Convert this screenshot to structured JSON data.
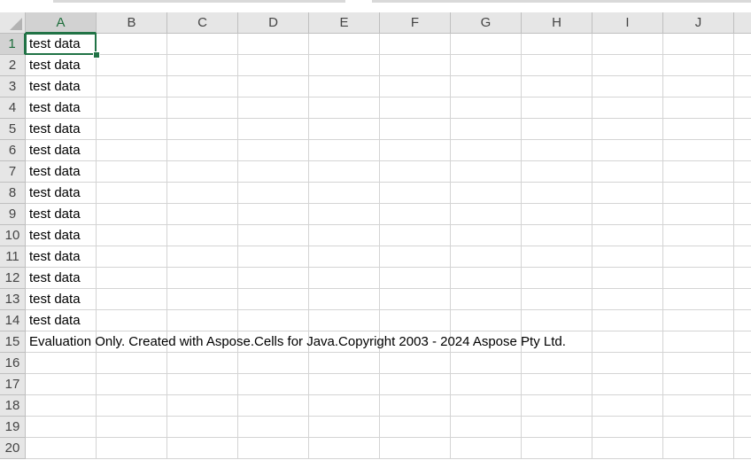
{
  "app": "Spreadsheet",
  "columns": [
    "A",
    "B",
    "C",
    "D",
    "E",
    "F",
    "G",
    "H",
    "I",
    "J"
  ],
  "rows": [
    "1",
    "2",
    "3",
    "4",
    "5",
    "6",
    "7",
    "8",
    "9",
    "10",
    "11",
    "12",
    "13",
    "14",
    "15",
    "16",
    "17",
    "18",
    "19",
    "20"
  ],
  "active_cell": "A1",
  "cells": [
    {
      "ref": "A1",
      "row": 1,
      "col": "A",
      "value": "test data"
    },
    {
      "ref": "A2",
      "row": 2,
      "col": "A",
      "value": "test data"
    },
    {
      "ref": "A3",
      "row": 3,
      "col": "A",
      "value": "test data"
    },
    {
      "ref": "A4",
      "row": 4,
      "col": "A",
      "value": "test data"
    },
    {
      "ref": "A5",
      "row": 5,
      "col": "A",
      "value": "test data"
    },
    {
      "ref": "A6",
      "row": 6,
      "col": "A",
      "value": "test data"
    },
    {
      "ref": "A7",
      "row": 7,
      "col": "A",
      "value": "test data"
    },
    {
      "ref": "A8",
      "row": 8,
      "col": "A",
      "value": "test data"
    },
    {
      "ref": "A9",
      "row": 9,
      "col": "A",
      "value": "test data"
    },
    {
      "ref": "A10",
      "row": 10,
      "col": "A",
      "value": "test data"
    },
    {
      "ref": "A11",
      "row": 11,
      "col": "A",
      "value": "test data"
    },
    {
      "ref": "A12",
      "row": 12,
      "col": "A",
      "value": "test data"
    },
    {
      "ref": "A13",
      "row": 13,
      "col": "A",
      "value": "test data"
    },
    {
      "ref": "A14",
      "row": 14,
      "col": "A",
      "value": "test data"
    },
    {
      "ref": "A15",
      "row": 15,
      "col": "A",
      "value": "Evaluation Only. Created with Aspose.Cells for Java.Copyright 2003 - 2024 Aspose Pty Ltd."
    }
  ],
  "colors": {
    "accent": "#217346",
    "header_bg": "#e6e6e6",
    "gridline": "#d4d4d4"
  }
}
